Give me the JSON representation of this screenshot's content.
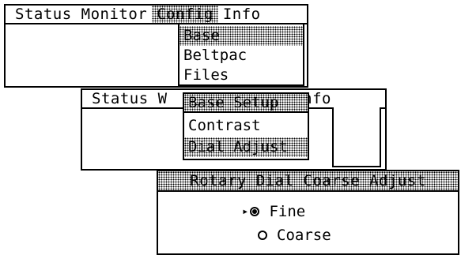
{
  "screen1": {
    "menu": [
      "Status",
      "Monitor",
      "Config",
      "Info"
    ],
    "dropdown": [
      "Base",
      "Beltpac",
      "Files"
    ]
  },
  "screen2": {
    "menu": [
      "Status",
      "W",
      "Info"
    ],
    "title": "Base Setup",
    "items": [
      "Contrast",
      "Dial Adjust"
    ]
  },
  "screen3": {
    "title": "Rotary Dial Coarse Adjust",
    "options": [
      {
        "label": "Fine",
        "selected": true,
        "marker": "▸"
      },
      {
        "label": "Coarse",
        "selected": false
      }
    ]
  }
}
